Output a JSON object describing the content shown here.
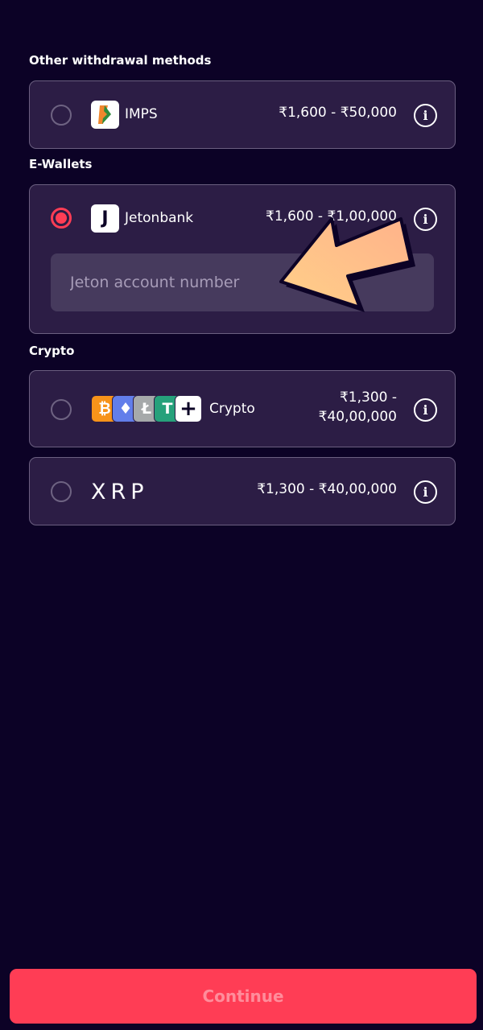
{
  "sections": {
    "other": "Other withdrawal methods",
    "ewallets": "E-Wallets",
    "crypto": "Crypto"
  },
  "methods": {
    "imps": {
      "name": "IMPS",
      "range": "₹1,600 - ₹50,000",
      "selected": false
    },
    "jetonbank": {
      "name": "Jetonbank",
      "range": "₹1,600 - ₹1,00,000",
      "selected": true,
      "logo_letter": "J",
      "input_placeholder": "Jeton account number"
    },
    "crypto": {
      "name": "Crypto",
      "range_line1": "₹1,300 -",
      "range_line2": "₹40,00,000",
      "selected": false,
      "coins": {
        "btc": "₿",
        "eth": "♦",
        "ltc": "Ł",
        "usdt": "T",
        "more": "+"
      }
    },
    "xrp": {
      "logo_text": "XRP",
      "range": "₹1,300 - ₹40,00,000",
      "selected": false
    }
  },
  "continue_label": "Continue",
  "colors": {
    "background": "#0c0226",
    "card": "#2c1d45",
    "accent": "#ff3d55",
    "annotation_arrow": "#ffc98a"
  }
}
